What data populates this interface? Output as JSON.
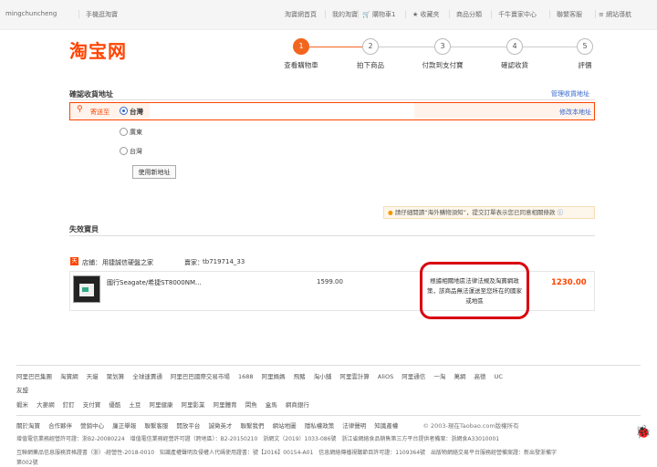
{
  "topbar": {
    "username": "mingchuncheng",
    "mobile": "手機逛淘寶",
    "home": "淘寶網首頁",
    "my": "我的淘寶",
    "cart": "購物車1",
    "favorites": "收藏夾",
    "categories": "商品分類",
    "seller": "千牛賣家中心",
    "service": "聯繫客服",
    "sitemap": "網站導航"
  },
  "logo": "淘宝网",
  "steps": [
    {
      "num": "1",
      "label": "查看購物車"
    },
    {
      "num": "2",
      "label": "拍下商品"
    },
    {
      "num": "3",
      "label": "付款到支付寶"
    },
    {
      "num": "4",
      "label": "確認收貨"
    },
    {
      "num": "5",
      "label": "評價"
    }
  ],
  "address": {
    "title": "確認收貨地址",
    "manage": "管理收貨地址",
    "send_to": "寄送至",
    "selected": "台灣",
    "modify": "修改本地址",
    "option2": "廣東省",
    "option3": "台灣新",
    "use_new": "使用新地址"
  },
  "notice": "請仔細閱讀“海外購物須知”，提交訂單表示您已同意相關條款",
  "invalid_title": "失效寶貝",
  "shop": {
    "badge": "天",
    "store_label": "店鋪：",
    "store_name": "用捷誠信硬盤之家",
    "seller_label": "賣家：",
    "seller_name": "tb719714_33"
  },
  "item": {
    "name": "國行Seagate/希捷ST8000NM...",
    "price": "1599.00",
    "total": "1230.00",
    "reason": "根據相關地區法律法規及淘寶網政策，該商品無法運送至您所在的國家或地區"
  },
  "footer": {
    "row1": [
      "阿里巴巴集團",
      "淘寶網",
      "天貓",
      "聚划算",
      "全球速賣通",
      "阿里巴巴國際交易市場",
      "1688",
      "阿里媽媽",
      "飛豬",
      "淘小舖",
      "阿里雲計算",
      "AliOS",
      "阿里通信",
      "一淘",
      "萬網",
      "高德",
      "UC"
    ],
    "row2": [
      "友盟"
    ],
    "row3": [
      "蝦米",
      "大麥網",
      "釘釘",
      "支付寶",
      "優酷",
      "土豆",
      "阿里健康",
      "阿里影業",
      "阿里體育",
      "閑魚",
      "盒馬",
      "網商銀行"
    ],
    "row4": [
      "關於淘寶",
      "合作夥伴",
      "營銷中心",
      "廉正舉報",
      "聯繫客服",
      "開放平台",
      "誠徵英才",
      "聯繫我們",
      "網站地圖",
      "隱私權政策",
      "法律聲明",
      "知識產權"
    ],
    "copyright": "© 2003-現在Taobao.com版權所有",
    "line5": "增值電信業務經營許可證：浙B2-20080224　增值電信業務經營許可證（跨地區）：B2-20150210　浙網文（2019）1033-086號　浙江省網絡食品銷售第三方平台提供者備案：浙網食A33010001",
    "line6": "互聯網藥品信息服務資格證書（浙）-經營性-2018-0010　知識產權聲明及侵權人代碼使用證書：號【2016】00154-A01　信息網絡傳播視聽節目許可證：1109364號　出版物網絡交易平台服務經營備案證：新出發浙備字",
    "line7": "第002號"
  },
  "colors": {
    "accent": "#f2651f",
    "link": "#3366cc",
    "alert": "#d8000f"
  }
}
